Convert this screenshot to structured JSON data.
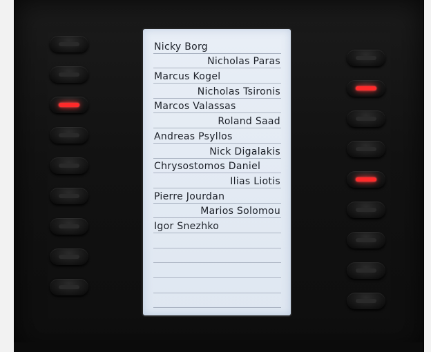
{
  "screen": {
    "entries": [
      {
        "name": "Nicky Borg",
        "align": "left"
      },
      {
        "name": "Nicholas Paras",
        "align": "right"
      },
      {
        "name": "Marcus Kogel",
        "align": "left"
      },
      {
        "name": "Nicholas Tsironis",
        "align": "right"
      },
      {
        "name": "Marcos Valassas",
        "align": "left"
      },
      {
        "name": "Roland Saad",
        "align": "right"
      },
      {
        "name": "Andreas Psyllos",
        "align": "left"
      },
      {
        "name": "Nick Digalakis",
        "align": "right"
      },
      {
        "name": "Chrysostomos Daniel",
        "align": "left"
      },
      {
        "name": "Ilias Liotis",
        "align": "right"
      },
      {
        "name": "Pierre Jourdan",
        "align": "left"
      },
      {
        "name": "Marios Solomou",
        "align": "right"
      },
      {
        "name": "Igor Snezhko",
        "align": "left"
      },
      {
        "name": "",
        "align": "right"
      },
      {
        "name": "",
        "align": "left"
      },
      {
        "name": "",
        "align": "right"
      },
      {
        "name": "",
        "align": "left"
      },
      {
        "name": "",
        "align": "right"
      }
    ]
  },
  "left_keys": [
    {
      "lit": false
    },
    {
      "lit": false
    },
    {
      "lit": true
    },
    {
      "lit": false
    },
    {
      "lit": false
    },
    {
      "lit": false
    },
    {
      "lit": false
    },
    {
      "lit": false
    },
    {
      "lit": false
    }
  ],
  "right_keys": [
    {
      "lit": false
    },
    {
      "lit": true
    },
    {
      "lit": false
    },
    {
      "lit": false
    },
    {
      "lit": true
    },
    {
      "lit": false
    },
    {
      "lit": false
    },
    {
      "lit": false
    },
    {
      "lit": false
    }
  ],
  "colors": {
    "led_on": "#ff2a2a",
    "led_off": "#2a2a2a",
    "screen_bg": "#e4ebf4",
    "text": "#1c2028",
    "body": "#151515"
  }
}
